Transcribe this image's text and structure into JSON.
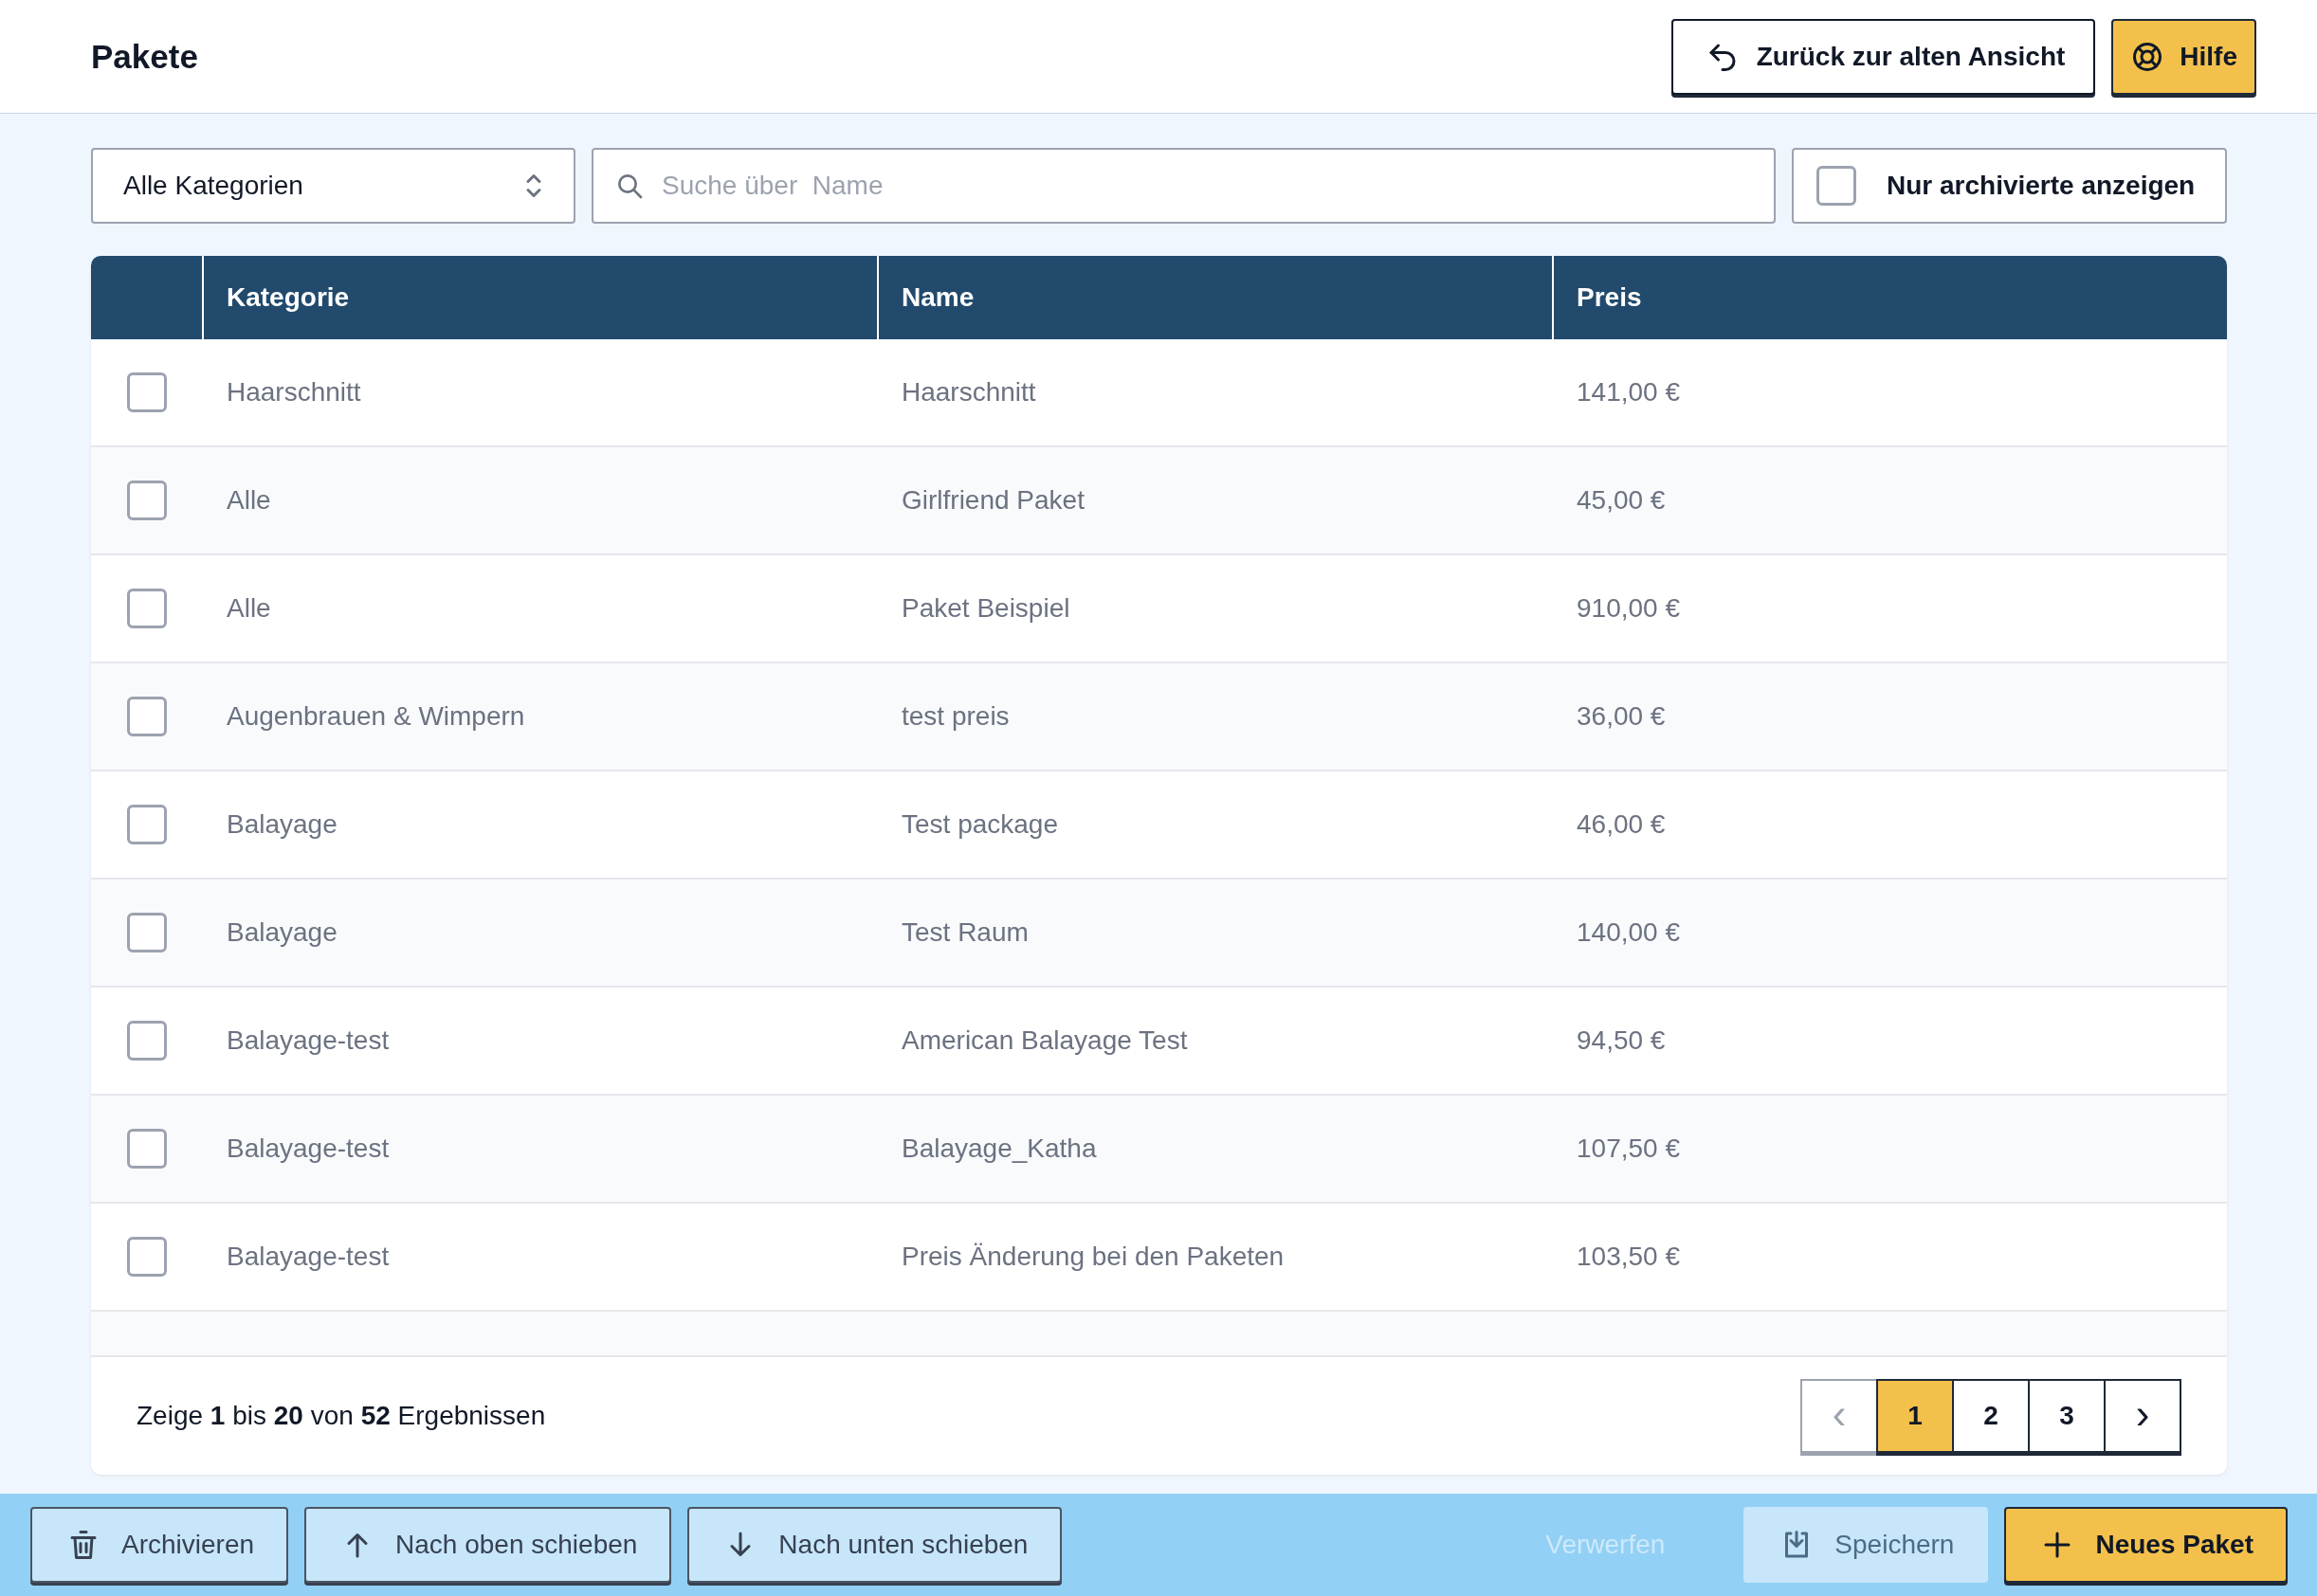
{
  "header": {
    "title": "Pakete",
    "buttons": [
      {
        "kind": "back",
        "label": "Zurück zur alten Ansicht"
      },
      {
        "kind": "help",
        "label": "Hilfe"
      }
    ]
  },
  "filters": {
    "category": {
      "value": "Alle Kategorien"
    },
    "search": {
      "placeholder": "Suche über  Name"
    },
    "archived": {
      "label": "Nur archivierte anzeigen",
      "checked": false
    }
  },
  "table": {
    "columns": [
      "Kategorie",
      "Name",
      "Preis"
    ],
    "rows": [
      {
        "checked": false,
        "cells": [
          "Haarschnitt",
          "Haarschnitt",
          "141,00 €"
        ]
      },
      {
        "checked": false,
        "cells": [
          "Alle",
          "Girlfriend Paket",
          "45,00 €"
        ]
      },
      {
        "checked": false,
        "cells": [
          "Alle",
          "Paket Beispiel",
          "910,00 €"
        ]
      },
      {
        "checked": false,
        "cells": [
          "Augenbrauen & Wimpern",
          "test preis",
          "36,00 €"
        ]
      },
      {
        "checked": false,
        "cells": [
          "Balayage",
          "Test package",
          "46,00 €"
        ]
      },
      {
        "checked": false,
        "cells": [
          "Balayage",
          "Test Raum",
          "140,00 €"
        ]
      },
      {
        "checked": false,
        "cells": [
          "Balayage-test",
          "American Balayage Test",
          "94,50 €"
        ]
      },
      {
        "checked": false,
        "cells": [
          "Balayage-test",
          "Balayage_Katha",
          "107,50 €"
        ]
      },
      {
        "checked": false,
        "cells": [
          "Balayage-test",
          "Preis Änderung bei den Paketen",
          "103,50 €"
        ]
      }
    ]
  },
  "footer": {
    "summary": "Zeige **1** bis **20** von **52** Ergebnissen",
    "pagination": {
      "prev": {
        "label": "‹",
        "disabled": true
      },
      "pages": [
        {
          "label": "1",
          "selected": true
        },
        {
          "label": "2",
          "selected": false
        },
        {
          "label": "3",
          "selected": false
        }
      ],
      "next": {
        "label": "›",
        "disabled": false
      }
    }
  },
  "actions": [
    {
      "kind": "archive",
      "label": "Archivieren",
      "disabled": false
    },
    {
      "kind": "up",
      "label": "Nach oben schieben",
      "disabled": false
    },
    {
      "kind": "down",
      "label": "Nach unten schieben",
      "disabled": false
    },
    {
      "kind": "discard",
      "label": "Verwerfen",
      "disabled": true
    },
    {
      "kind": "save",
      "label": "Speichern",
      "disabled": true
    },
    {
      "kind": "new",
      "label": "Neues Paket",
      "disabled": false
    }
  ]
}
